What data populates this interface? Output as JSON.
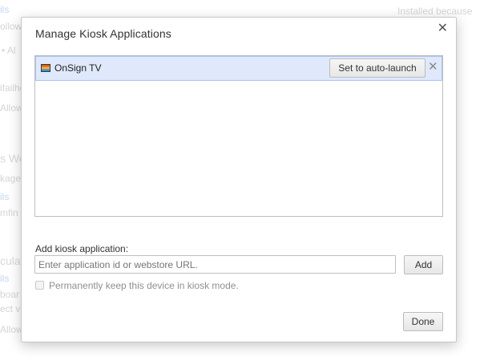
{
  "background": {
    "fragments": [
      {
        "text": "ils",
        "kind": "link"
      },
      {
        "text": "ollow",
        "kind": "text"
      },
      {
        "text": "• Al",
        "kind": "text"
      },
      {
        "text": "Installed because",
        "kind": "text"
      },
      {
        "text": "ifailhe",
        "kind": "text"
      },
      {
        "text": "Allow",
        "kind": "text"
      },
      {
        "text": "s We",
        "kind": "head"
      },
      {
        "text": "kage",
        "kind": "text"
      },
      {
        "text": "ils",
        "kind": "link"
      },
      {
        "text": "mfin",
        "kind": "text"
      },
      {
        "text": "cula",
        "kind": "head"
      },
      {
        "text": "ils",
        "kind": "link"
      },
      {
        "text": "boar",
        "kind": "text"
      },
      {
        "text": "ect vi",
        "kind": "text"
      },
      {
        "text": "Allow",
        "kind": "text"
      }
    ]
  },
  "dialog": {
    "title": "Manage Kiosk Applications",
    "close_icon": "close-icon",
    "apps": [
      {
        "name": "OnSign TV",
        "icon": "onsign-tv-app-icon",
        "auto_launch_label": "Set to auto-launch",
        "remove_icon": "remove-icon"
      }
    ],
    "add_label": "Add kiosk application:",
    "add_input": {
      "value": "",
      "placeholder": "Enter application id or webstore URL."
    },
    "add_button": "Add",
    "kiosk_mode_checkbox": {
      "checked": false,
      "label": "Permanently keep this device in kiosk mode."
    },
    "done_button": "Done"
  },
  "colors": {
    "selected_row": "#dfe9fb",
    "selected_row_border": "#a6c2f2",
    "disabled_text": "#8f8f8f"
  }
}
